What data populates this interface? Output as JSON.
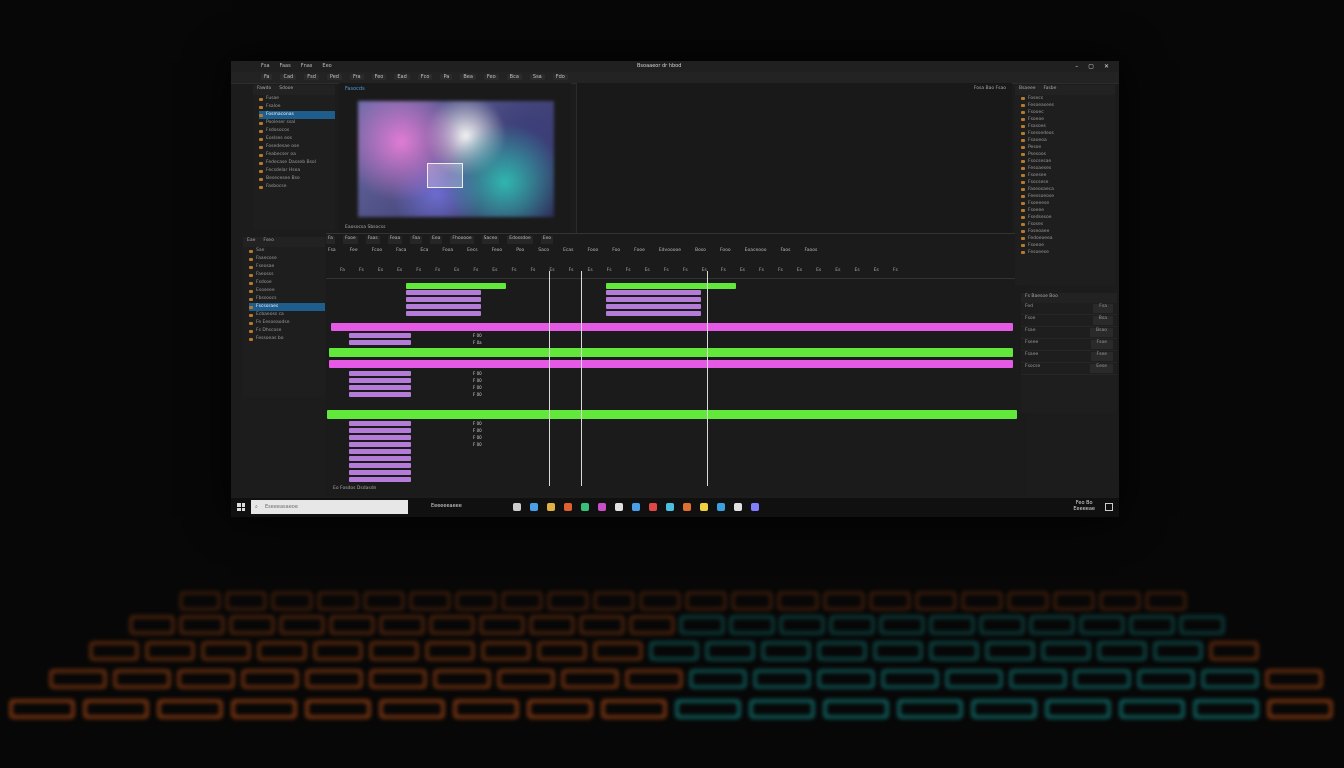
{
  "window": {
    "title": "Bsoaaeor dr hbod",
    "menu": [
      "Fsa",
      "Faas",
      "Fnas",
      "Eeo"
    ],
    "controls": [
      "–",
      "▢",
      "✕"
    ]
  },
  "toolbar": {
    "items": [
      "Fa",
      "Cad",
      "Fsd",
      "Ped",
      "Fra",
      "Feo",
      "Ead",
      "Fco",
      "Pa",
      "Bea",
      "Feo",
      "Bca",
      "Ssa",
      "Fdo"
    ]
  },
  "project_panel": {
    "header": [
      "Fawdo",
      "Sdooe"
    ],
    "items": [
      {
        "label": "Fusae",
        "selected": false
      },
      {
        "label": "Fsaloe",
        "selected": false
      },
      {
        "label": "Fosmaconas",
        "selected": true
      },
      {
        "label": "Pooleser ssal",
        "selected": false
      },
      {
        "label": "Fsdosocos",
        "selected": false
      },
      {
        "label": "Eoslses eos",
        "selected": false
      },
      {
        "label": "Fosedesae ose",
        "selected": false
      },
      {
        "label": "Feabecser oa",
        "selected": false
      },
      {
        "label": "Fedecase Dasseb Bsol",
        "selected": false
      },
      {
        "label": "Fecsdelar Hsea",
        "selected": false
      },
      {
        "label": "Besecesee Bse",
        "selected": false
      },
      {
        "label": "Fasbocse",
        "selected": false
      }
    ]
  },
  "media_panel": {
    "header": [
      "Eae",
      "Fseo"
    ],
    "items": [
      {
        "label": "Sae",
        "selected": false
      },
      {
        "label": "Faaecose",
        "selected": false
      },
      {
        "label": "Fseosae",
        "selected": false
      },
      {
        "label": "Faeosss",
        "selected": false
      },
      {
        "label": "Fsdsoe",
        "selected": false
      },
      {
        "label": "Esoseee",
        "selected": false
      },
      {
        "label": "Fbssoocs",
        "selected": false
      },
      {
        "label": "Fscsoraes",
        "selected": true
      },
      {
        "label": "Ecbaeoss ca",
        "selected": false
      },
      {
        "label": "Fe Eesoeaodse",
        "selected": false
      },
      {
        "label": "Fs Dhscose",
        "selected": false
      },
      {
        "label": "Fessoeas bo",
        "selected": false
      }
    ]
  },
  "monitor": {
    "label": "Fasocds",
    "footer": "Eaosocsa Sbsocss",
    "right_controls": "Fosa Bao Fsao"
  },
  "timeline": {
    "tabs": [
      "Fa",
      "Fooe",
      "Faas",
      "Feaa",
      "Faa",
      "Eea",
      "Fhooooe",
      "Saceo",
      "Edossdoe",
      "Eeo"
    ],
    "subtabs": [
      "Fsa",
      "Fee",
      "Fcoo",
      "Faca",
      "Eca",
      "Fooa",
      "Eecs",
      "Feoo",
      "Poo",
      "Saco",
      "Ecas",
      "Fooo",
      "Foo",
      "Fooe",
      "Edvooooe",
      "Boso",
      "Fooo",
      "Eoaceooo",
      "Faos",
      "Faoos"
    ],
    "ruler": [
      "Fa",
      "Fs",
      "Es",
      "Es",
      "Fs",
      "Fs",
      "Es",
      "Fs",
      "Es",
      "Fs",
      "Fs",
      "Es",
      "Fs",
      "Es",
      "Fs",
      "Fs",
      "Es",
      "Fs",
      "Fs",
      "Es",
      "Fs",
      "Es",
      "Fs",
      "Fs",
      "Es",
      "Es",
      "Es",
      "Es",
      "Es",
      "Fs"
    ],
    "timecodes": [
      "F 00",
      "F 0a",
      "F 00",
      "F 00",
      "F 00",
      "F 00",
      "F 00",
      "F 00",
      "F 00",
      "F 00"
    ],
    "footer": "Eo Fosdos Dsdasdn"
  },
  "effects_panel": {
    "header": [
      "Bsaeee",
      "Fasbe"
    ],
    "items": [
      "Fosecs",
      "Fesoeasees",
      "Fsooec",
      "Fsoeoe",
      "Fsasoes",
      "Fsessedeos",
      "Fsaoeoa",
      "Pesoe",
      "Psesoos",
      "Fsocsesae",
      "Fesoaeses",
      "Fsoesee",
      "Fsocsese",
      "Faseosaeca",
      "Feessoeose",
      "Fsoeeese",
      "Fsoeee",
      "Fsedsesoe",
      "Fsoses",
      "Foseoaee",
      "Fedoeoeea",
      "Fsoeoe",
      "Fesoeese"
    ]
  },
  "properties_panel": {
    "header": "Fs Baesoe Boo",
    "rows": [
      {
        "label": "Fed",
        "value": "Fsa"
      },
      {
        "label": "Fsoe",
        "value": "Bsa"
      },
      {
        "label": "Fsae",
        "value": "Bsao"
      },
      {
        "label": "Fseee",
        "value": "Fsoe"
      },
      {
        "label": "Fsaee",
        "value": "Fsee"
      },
      {
        "label": "Fsocse",
        "value": "Eese"
      }
    ]
  },
  "taskbar": {
    "search_placeholder": "Eseeeasaeoe",
    "app_label": "Eeeeeeaeee",
    "clock_time": "Feo Bo",
    "clock_date": "Eeeeeae"
  },
  "colors": {
    "magenta_clip": "#e45ae4",
    "green_clip": "#62e83a",
    "lilac_clip": "#b57bd9",
    "selection": "#1f5e8c",
    "keyboard_orange": "#ff6a1a",
    "keyboard_teal": "#18c5c0"
  }
}
